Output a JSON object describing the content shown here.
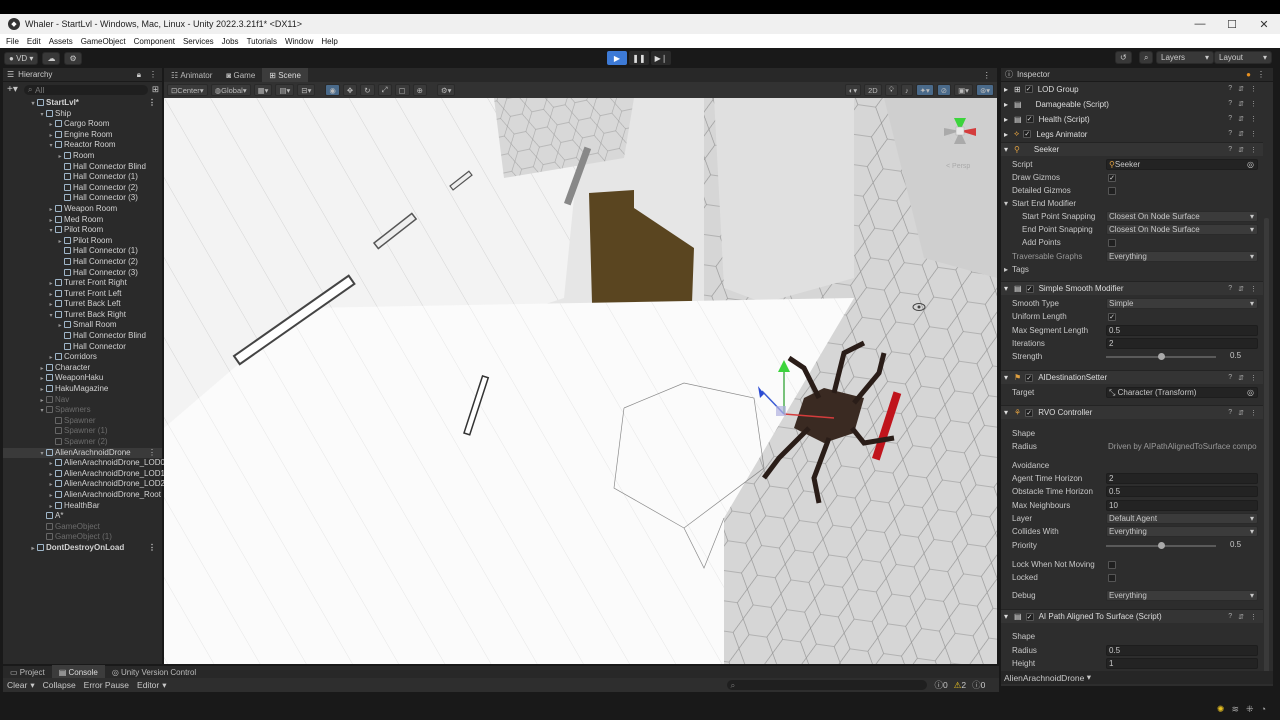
{
  "window": {
    "title": "Whaler - StartLvl - Windows, Mac, Linux - Unity 2022.3.21f1* <DX11>",
    "controls": [
      "—",
      "☐",
      "✕"
    ]
  },
  "menu": [
    "File",
    "Edit",
    "Assets",
    "GameObject",
    "Component",
    "Services",
    "Jobs",
    "Tutorials",
    "Window",
    "Help"
  ],
  "toolbar": {
    "account": "VD",
    "layers_label": "Layers",
    "layout_label": "Layout"
  },
  "hierarchy": {
    "title": "Hierarchy",
    "search_placeholder": "All",
    "items": [
      {
        "label": "StartLvl*",
        "depth": 0,
        "kind": "scene",
        "arrow": "▾"
      },
      {
        "label": "Ship",
        "depth": 1,
        "arrow": "▾"
      },
      {
        "label": "Cargo Room",
        "depth": 2,
        "arrow": "▸"
      },
      {
        "label": "Engine Room",
        "depth": 2,
        "arrow": "▸"
      },
      {
        "label": "Reactor Room",
        "depth": 2,
        "arrow": "▾"
      },
      {
        "label": "Room",
        "depth": 3,
        "arrow": "▸"
      },
      {
        "label": "Hall Connector Blind",
        "depth": 3,
        "arrow": ""
      },
      {
        "label": "Hall Connector (1)",
        "depth": 3,
        "arrow": ""
      },
      {
        "label": "Hall Connector (2)",
        "depth": 3,
        "arrow": ""
      },
      {
        "label": "Hall Connector (3)",
        "depth": 3,
        "arrow": ""
      },
      {
        "label": "Weapon Room",
        "depth": 2,
        "arrow": "▸"
      },
      {
        "label": "Med Room",
        "depth": 2,
        "arrow": "▸"
      },
      {
        "label": "Pilot Room",
        "depth": 2,
        "arrow": "▾"
      },
      {
        "label": "Pilot Room",
        "depth": 3,
        "arrow": "▸"
      },
      {
        "label": "Hall Connector (1)",
        "depth": 3,
        "arrow": ""
      },
      {
        "label": "Hall Connector (2)",
        "depth": 3,
        "arrow": ""
      },
      {
        "label": "Hall Connector (3)",
        "depth": 3,
        "arrow": ""
      },
      {
        "label": "Turret Front Right",
        "depth": 2,
        "arrow": "▸"
      },
      {
        "label": "Turret Front Left",
        "depth": 2,
        "arrow": "▸"
      },
      {
        "label": "Turret Back Left",
        "depth": 2,
        "arrow": "▸"
      },
      {
        "label": "Turret Back Right",
        "depth": 2,
        "arrow": "▾"
      },
      {
        "label": "Small Room",
        "depth": 3,
        "arrow": "▸"
      },
      {
        "label": "Hall Connector Blind",
        "depth": 3,
        "arrow": ""
      },
      {
        "label": "Hall Connector",
        "depth": 3,
        "arrow": ""
      },
      {
        "label": "Corridors",
        "depth": 2,
        "arrow": "▸"
      },
      {
        "label": "Character",
        "depth": 1,
        "arrow": "▸"
      },
      {
        "label": "WeaponHaku",
        "depth": 1,
        "arrow": "▸"
      },
      {
        "label": "HakuMagazine",
        "depth": 1,
        "arrow": "▸"
      },
      {
        "label": "Nav",
        "depth": 1,
        "arrow": "▸",
        "dim": true
      },
      {
        "label": "Spawners",
        "depth": 1,
        "arrow": "▾",
        "dim": true
      },
      {
        "label": "Spawner",
        "depth": 2,
        "arrow": "",
        "dim": true
      },
      {
        "label": "Spawner (1)",
        "depth": 2,
        "arrow": "",
        "dim": true
      },
      {
        "label": "Spawner (2)",
        "depth": 2,
        "arrow": "",
        "dim": true
      },
      {
        "label": "AlienArachnoidDrone",
        "depth": 1,
        "arrow": "▾",
        "selected": true
      },
      {
        "label": "AlienArachnoidDrone_LOD0",
        "depth": 2,
        "arrow": "▸"
      },
      {
        "label": "AlienArachnoidDrone_LOD1",
        "depth": 2,
        "arrow": "▸"
      },
      {
        "label": "AlienArachnoidDrone_LOD2",
        "depth": 2,
        "arrow": "▸"
      },
      {
        "label": "AlienArachnoidDrone_Root",
        "depth": 2,
        "arrow": "▸"
      },
      {
        "label": "HealthBar",
        "depth": 2,
        "arrow": "▸"
      },
      {
        "label": "A*",
        "depth": 1,
        "arrow": ""
      },
      {
        "label": "GameObject",
        "depth": 1,
        "arrow": "",
        "dim": true
      },
      {
        "label": "GameObject (1)",
        "depth": 1,
        "arrow": "",
        "dim": true
      },
      {
        "label": "DontDestroyOnLoad",
        "depth": 0,
        "kind": "scene",
        "arrow": "▸"
      }
    ]
  },
  "scene": {
    "tabs": [
      "Animator",
      "Game",
      "Scene"
    ],
    "active_tab": "Scene",
    "pivot_label": "Center",
    "space_label": "Global",
    "mode_2d": "2D",
    "gizmo_label": "< Persp"
  },
  "inspector": {
    "title": "Inspector",
    "components": [
      {
        "name": "LOD Group",
        "checkbox": true
      },
      {
        "name": "Damageable (Script)",
        "checkbox": false
      },
      {
        "name": "Health (Script)",
        "checkbox": true
      },
      {
        "name": "Legs Animator",
        "checkbox": true
      },
      {
        "name": "Seeker",
        "checkbox": false
      }
    ],
    "seeker": {
      "script_label": "Script",
      "script_value": "Seeker",
      "draw_gizmos_label": "Draw Gizmos",
      "draw_gizmos": "✓",
      "detailed_gizmos_label": "Detailed Gizmos",
      "start_end_label": "Start End Modifier",
      "start_snap_label": "Start Point Snapping",
      "start_snap_value": "Closest On Node Surface",
      "end_snap_label": "End Point Snapping",
      "end_snap_value": "Closest On Node Surface",
      "add_points_label": "Add Points",
      "traversable_label": "Traversable Graphs",
      "traversable_value": "Everything",
      "tags_label": "Tags"
    },
    "smooth": {
      "name": "Simple Smooth Modifier",
      "smooth_type_label": "Smooth Type",
      "smooth_type_value": "Simple",
      "uniform_label": "Uniform Length",
      "uniform_value": "✓",
      "max_seg_label": "Max Segment Length",
      "max_seg_value": "0.5",
      "iterations_label": "Iterations",
      "iterations_value": "2",
      "strength_label": "Strength",
      "strength_value": "0.5",
      "strength_fraction": 0.5
    },
    "destination": {
      "name": "AIDestinationSetter",
      "target_label": "Target",
      "target_value": "Character (Transform)"
    },
    "rvo": {
      "name": "RVO Controller",
      "shape_label": "Shape",
      "radius_label": "Radius",
      "radius_value": "Driven by AIPathAlignedToSurface compo",
      "avoidance_label": "Avoidance",
      "agent_time_label": "Agent Time Horizon",
      "agent_time_value": "2",
      "obstacle_time_label": "Obstacle Time Horizon",
      "obstacle_time_value": "0.5",
      "max_neighbours_label": "Max Neighbours",
      "max_neighbours_value": "10",
      "layer_label": "Layer",
      "layer_value": "Default Agent",
      "collides_label": "Collides With",
      "collides_value": "Everything",
      "priority_label": "Priority",
      "priority_value": "0.5",
      "priority_fraction": 0.5,
      "lock_label": "Lock When Not Moving",
      "locked_label": "Locked",
      "debug_label": "Debug",
      "debug_value": "Everything"
    },
    "aipath": {
      "name": "AI Path Aligned To Surface (Script)",
      "shape_label": "Shape",
      "radius_label": "Radius",
      "radius_value": "0.5",
      "height_label": "Height",
      "height_value": "1"
    },
    "footer": "AlienArachnoidDrone"
  },
  "bottom": {
    "tabs": [
      "Project",
      "Console",
      "Unity Version Control"
    ],
    "console_buttons": [
      "Clear",
      "Collapse",
      "Error Pause",
      "Editor"
    ],
    "counts": {
      "info": "0",
      "warn": "2",
      "error": "0"
    }
  },
  "colors": {
    "accent": "#4a90d9",
    "play": "#3d7ad6",
    "char_red": "#c0141c",
    "door_brown": "#5a4520"
  }
}
